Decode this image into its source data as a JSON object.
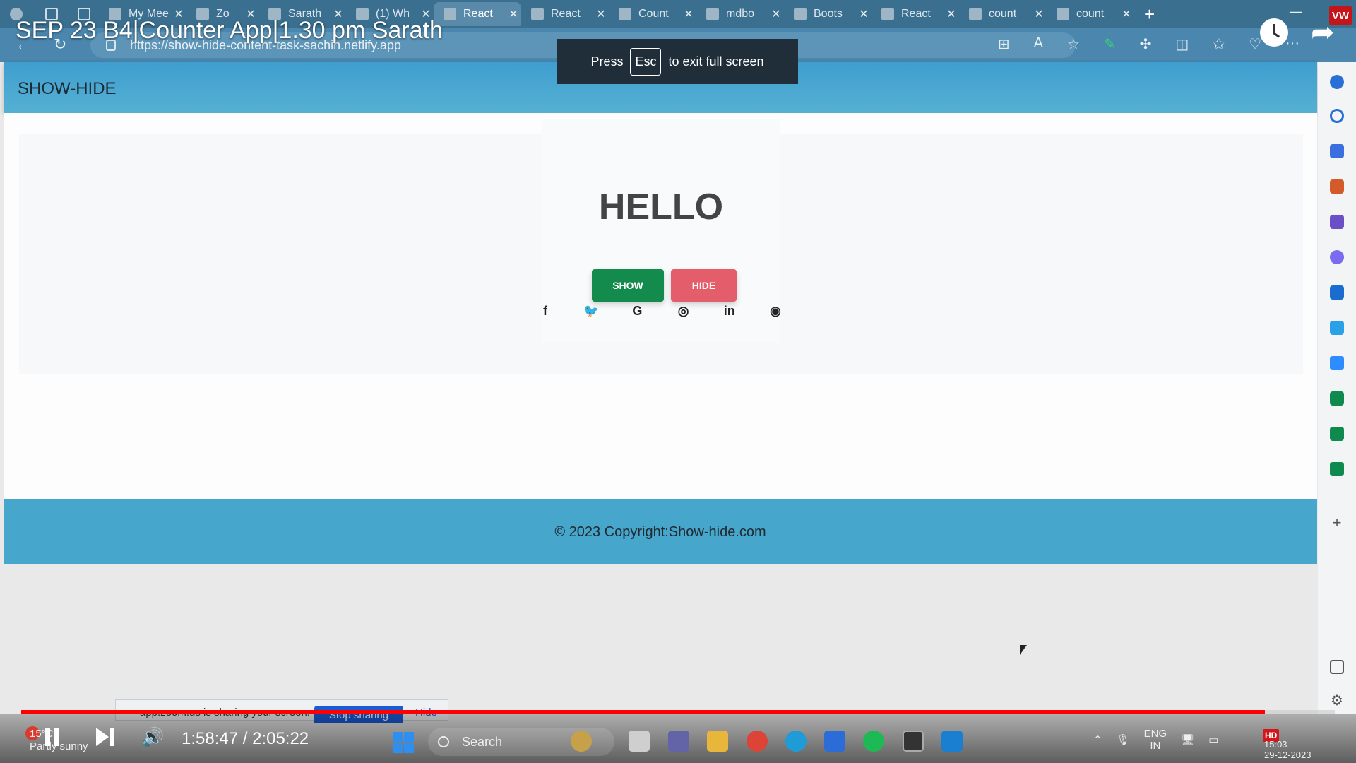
{
  "video": {
    "title": "SEP 23 B4|Counter App|1.30 pm Sarath",
    "time": "1:58:47 / 2:05:22",
    "progress": 0.947
  },
  "browser": {
    "tabs": [
      {
        "label": "My Mee"
      },
      {
        "label": "Zo"
      },
      {
        "label": "Sarath"
      },
      {
        "label": "(1) Wh"
      },
      {
        "label": "React",
        "active": true
      },
      {
        "label": "React"
      },
      {
        "label": "Count"
      },
      {
        "label": "mdbo"
      },
      {
        "label": "Boots"
      },
      {
        "label": "React"
      },
      {
        "label": "count"
      },
      {
        "label": "count"
      }
    ],
    "url": "https://show-hide-content-task-sachin.netlify.app",
    "new_tab": "+"
  },
  "fullscreen_toast": {
    "press": "Press",
    "key": "Esc",
    "message": "to exit full screen"
  },
  "site": {
    "brand": "SHOW-HIDE",
    "heading": "HELLO",
    "show_button": "SHOW",
    "hide_button": "HIDE",
    "social": {
      "facebook": "f",
      "twitter": "🐦",
      "google": "G",
      "instagram": "◎",
      "linkedin": "in",
      "github": "◉"
    },
    "footer": "© 2023 Copyright:Show-hide.com"
  },
  "zoom_share": {
    "message": "app.zoom.us is sharing your screen.",
    "stop": "Stop sharing",
    "hide": "Hide"
  },
  "taskbar": {
    "weather_temp": "15°C",
    "weather_desc": "Partly sunny",
    "weather_badge": "1",
    "search": "Search",
    "lang_top": "ENG",
    "lang_bottom": "IN",
    "hd": "HD",
    "time": "15:03",
    "date": "29-12-2023"
  },
  "colors": {
    "navbar": "#46a6cb",
    "show": "#138b4c",
    "hide": "#e35d6a",
    "progress": "#ff0000"
  }
}
